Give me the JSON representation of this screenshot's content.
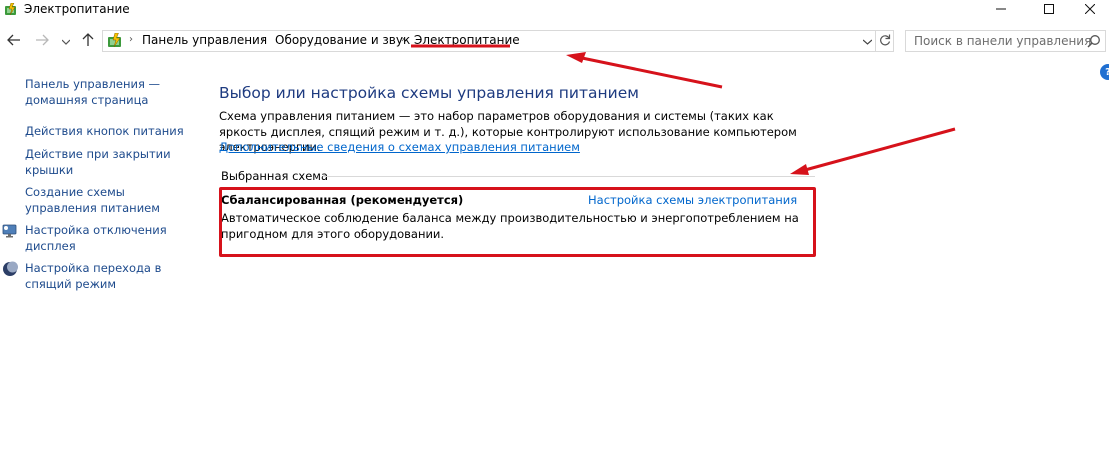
{
  "window": {
    "title": "Электропитание",
    "icon": "power-options-icon",
    "controls": [
      "minimize-icon",
      "maximize-icon",
      "close-icon"
    ]
  },
  "navigation": {
    "back_icon": "arrow-left-icon",
    "forward_icon": "arrow-right-icon",
    "recent_icon": "chevron-down-icon",
    "up_icon": "arrow-up-icon"
  },
  "address_bar": {
    "breadcrumbs": [
      "Панель управления",
      "Оборудование и звук",
      "Электропитание"
    ],
    "separator": "›",
    "refresh_icon": "refresh-icon"
  },
  "search": {
    "placeholder": "Поиск в панели управления",
    "icon": "search-icon"
  },
  "sidebar": {
    "home_link": "Панель управления — домашняя страница",
    "items": [
      {
        "label": "Действия кнопок питания",
        "icon": null
      },
      {
        "label": "Действие при закрытии крышки",
        "icon": null
      },
      {
        "label": "Создание схемы управления питанием",
        "icon": null
      },
      {
        "label": "Настройка отключения дисплея",
        "icon": "monitor-icon"
      },
      {
        "label": "Настройка перехода в спящий режим",
        "icon": "moon-icon"
      }
    ]
  },
  "main": {
    "title": "Выбор или настройка схемы управления питанием",
    "description": "Схема управления питанием — это набор параметров оборудования и системы (таких как яркость дисплея, спящий режим и т. д.), которые контролируют использование компьютером электроэнергии.",
    "more_info_link": "Дополнительные сведения о схемах управления питанием",
    "selected_group_label": "Выбранная схема",
    "plan": {
      "name": "Сбалансированная (рекомендуется)",
      "settings_link": "Настройка схемы электропитания",
      "description": "Автоматическое соблюдение баланса между производительностью и энергопотреблением на пригодном для этого оборудовании."
    },
    "help_icon": "help-icon",
    "help_glyph": "?"
  },
  "annotations": {
    "color": "#d6121b"
  }
}
